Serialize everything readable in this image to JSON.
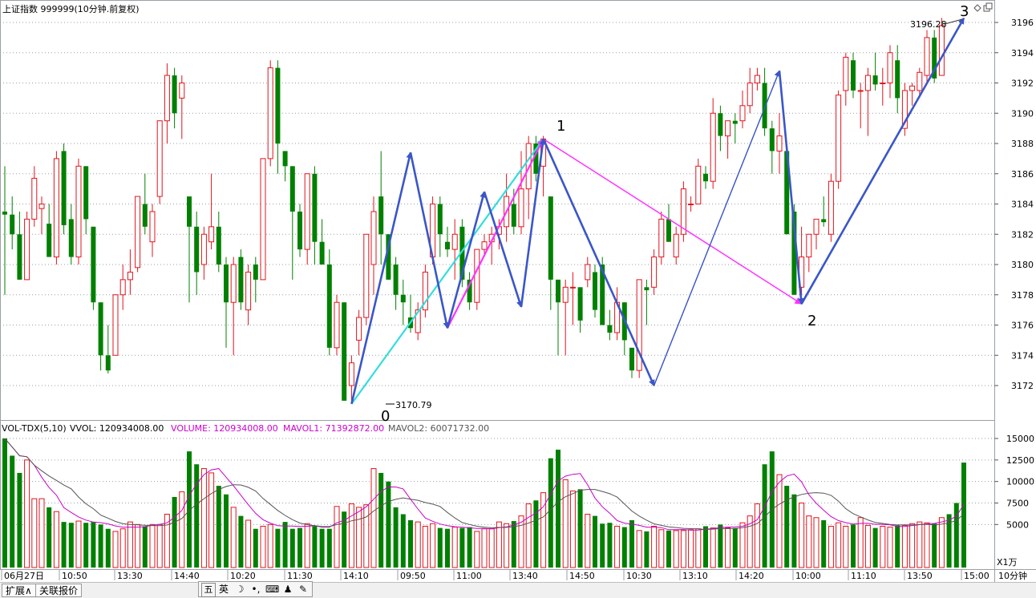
{
  "header": {
    "title": "上证指数 999999(10分钟.前复权)",
    "icons": [
      "diamond-icon",
      "restore-icon"
    ]
  },
  "volume_header": {
    "name": "VOL-TDX(5,10)",
    "vvol": "VVOL: 120934008.00",
    "volume": "VOLUME: 120934008.00",
    "mavol1": "MAVOL1: 71392872.00",
    "mavol2": "MAVOL2: 60071732.00"
  },
  "price_axis": [
    "3196",
    "3194",
    "3192",
    "3190",
    "3188",
    "3186",
    "3184",
    "3182",
    "3180",
    "3178",
    "3176",
    "3174",
    "3172"
  ],
  "volume_axis": [
    "15000",
    "12500",
    "10000",
    "7500",
    "5000"
  ],
  "volume_unit": "X1万",
  "time_axis": [
    "06月27日",
    "10:50",
    "13:30",
    "14:40",
    "10:20",
    "11:30",
    "14:10",
    "09:50",
    "11:00",
    "13:40",
    "14:50",
    "10:30",
    "13:10",
    "14:20",
    "10:00",
    "11:10",
    "13:50",
    "15:00"
  ],
  "period_label": "10分钟",
  "annotations": {
    "low_price": "3170.79",
    "high_price": "3196.28",
    "wave_labels": [
      "0",
      "1",
      "2",
      "3"
    ]
  },
  "status_bar": {
    "expand_button": "扩展∧",
    "quote_button": "关联报价",
    "ime_items": [
      "五",
      "英",
      "☽",
      "•,",
      "⌨",
      "♟",
      "✎"
    ]
  },
  "colors": {
    "up": "#e0141e",
    "down": "#008000",
    "ma1": "#cc00cc",
    "ma2": "#555555",
    "wave_blue": "#3a56c8",
    "magenta_line": "#ff33ff",
    "cyan_line": "#33dddd"
  },
  "chart_data": {
    "type": "candlestick",
    "ylim": [
      3170,
      3197
    ],
    "volume_ylim": [
      0,
      16000
    ],
    "candles": [
      {
        "o": 3183.5,
        "h": 3186.5,
        "l": 3178,
        "c": 3183.3
      },
      {
        "o": 3183.3,
        "h": 3184.5,
        "l": 3181,
        "c": 3182
      },
      {
        "o": 3182,
        "h": 3183.5,
        "l": 3179,
        "c": 3179
      },
      {
        "o": 3179,
        "h": 3183.5,
        "l": 3179,
        "c": 3183
      },
      {
        "o": 3183,
        "h": 3186.5,
        "l": 3182.5,
        "c": 3185.7
      },
      {
        "o": 3183.7,
        "h": 3184.5,
        "l": 3182,
        "c": 3184
      },
      {
        "o": 3182.7,
        "h": 3184,
        "l": 3180.5,
        "c": 3180.5
      },
      {
        "o": 3180.5,
        "h": 3187.5,
        "l": 3180,
        "c": 3187
      },
      {
        "o": 3187.5,
        "h": 3188,
        "l": 3182,
        "c": 3182.6
      },
      {
        "o": 3183,
        "h": 3184,
        "l": 3180,
        "c": 3180.5
      },
      {
        "o": 3180.5,
        "h": 3187,
        "l": 3180,
        "c": 3186.5
      },
      {
        "o": 3186.5,
        "h": 3186.5,
        "l": 3182,
        "c": 3183
      },
      {
        "o": 3182.5,
        "h": 3182.5,
        "l": 3177,
        "c": 3177.5
      },
      {
        "o": 3177.5,
        "h": 3177.5,
        "l": 3173,
        "c": 3174
      },
      {
        "o": 3174,
        "h": 3176,
        "l": 3172.8,
        "c": 3173
      },
      {
        "o": 3174,
        "h": 3178,
        "l": 3174,
        "c": 3178
      },
      {
        "o": 3178,
        "h": 3180,
        "l": 3177,
        "c": 3179
      },
      {
        "o": 3179,
        "h": 3181,
        "l": 3178,
        "c": 3179.5
      },
      {
        "o": 3179.8,
        "h": 3184.5,
        "l": 3179.5,
        "c": 3184.5
      },
      {
        "o": 3184,
        "h": 3186,
        "l": 3182,
        "c": 3182.5
      },
      {
        "o": 3181.5,
        "h": 3184,
        "l": 3180.5,
        "c": 3183.5
      },
      {
        "o": 3184.5,
        "h": 3189.5,
        "l": 3184,
        "c": 3189.5
      },
      {
        "o": 3189.5,
        "h": 3193.3,
        "l": 3188,
        "c": 3192.5
      },
      {
        "o": 3192.5,
        "h": 3193,
        "l": 3189,
        "c": 3190
      },
      {
        "o": 3191,
        "h": 3192.5,
        "l": 3188.3,
        "c": 3192
      },
      {
        "o": 3184.5,
        "h": 3184.5,
        "l": 3177.5,
        "c": 3182.5
      },
      {
        "o": 3182.5,
        "h": 3183.5,
        "l": 3178,
        "c": 3179.5
      },
      {
        "o": 3180,
        "h": 3182.5,
        "l": 3179,
        "c": 3182
      },
      {
        "o": 3181.5,
        "h": 3186,
        "l": 3181,
        "c": 3182.5
      },
      {
        "o": 3182.5,
        "h": 3183.5,
        "l": 3179.5,
        "c": 3180
      },
      {
        "o": 3180,
        "h": 3180.5,
        "l": 3174.5,
        "c": 3177.5
      },
      {
        "o": 3177.5,
        "h": 3180.5,
        "l": 3174,
        "c": 3180
      },
      {
        "o": 3180.5,
        "h": 3181,
        "l": 3177,
        "c": 3177.5
      },
      {
        "o": 3177,
        "h": 3180,
        "l": 3176,
        "c": 3179.5
      },
      {
        "o": 3180,
        "h": 3180.5,
        "l": 3177.5,
        "c": 3179
      },
      {
        "o": 3179,
        "h": 3187,
        "l": 3179,
        "c": 3187
      },
      {
        "o": 3187,
        "h": 3193.5,
        "l": 3186.5,
        "c": 3193
      },
      {
        "o": 3193,
        "h": 3193.5,
        "l": 3186,
        "c": 3188
      },
      {
        "o": 3187.5,
        "h": 3187.5,
        "l": 3185.5,
        "c": 3186.5
      },
      {
        "o": 3186.5,
        "h": 3186.5,
        "l": 3179,
        "c": 3183.5
      },
      {
        "o": 3183.5,
        "h": 3184,
        "l": 3180.5,
        "c": 3181
      },
      {
        "o": 3181,
        "h": 3186,
        "l": 3180,
        "c": 3186
      },
      {
        "o": 3186,
        "h": 3186.5,
        "l": 3180,
        "c": 3181.5
      },
      {
        "o": 3181.5,
        "h": 3183,
        "l": 3180,
        "c": 3180
      },
      {
        "o": 3180,
        "h": 3181,
        "l": 3174,
        "c": 3174.5
      },
      {
        "o": 3174.5,
        "h": 3178,
        "l": 3174,
        "c": 3177.5
      },
      {
        "o": 3177.5,
        "h": 3177.5,
        "l": 3171,
        "c": 3171
      },
      {
        "o": 3172,
        "h": 3174,
        "l": 3171,
        "c": 3173.5
      },
      {
        "o": 3175,
        "h": 3177,
        "l": 3174,
        "c": 3176.5
      },
      {
        "o": 3176.5,
        "h": 3182,
        "l": 3176,
        "c": 3182
      },
      {
        "o": 3180,
        "h": 3184.5,
        "l": 3178,
        "c": 3183.5
      },
      {
        "o": 3184.5,
        "h": 3187.5,
        "l": 3180,
        "c": 3182
      },
      {
        "o": 3182,
        "h": 3182,
        "l": 3179,
        "c": 3179
      },
      {
        "o": 3180,
        "h": 3180.5,
        "l": 3177,
        "c": 3178
      },
      {
        "o": 3178,
        "h": 3179,
        "l": 3176,
        "c": 3177.5
      },
      {
        "o": 3176.5,
        "h": 3178,
        "l": 3175.5,
        "c": 3175.8
      },
      {
        "o": 3175.5,
        "h": 3177.5,
        "l": 3175,
        "c": 3177
      },
      {
        "o": 3177,
        "h": 3180,
        "l": 3176.5,
        "c": 3179.5
      },
      {
        "o": 3180.5,
        "h": 3184.5,
        "l": 3180,
        "c": 3184
      },
      {
        "o": 3184,
        "h": 3184.5,
        "l": 3180.5,
        "c": 3182
      },
      {
        "o": 3181.5,
        "h": 3182.5,
        "l": 3180.5,
        "c": 3181
      },
      {
        "o": 3181,
        "h": 3183,
        "l": 3179,
        "c": 3182
      },
      {
        "o": 3182.5,
        "h": 3183,
        "l": 3178.5,
        "c": 3179
      },
      {
        "o": 3179,
        "h": 3179.5,
        "l": 3177,
        "c": 3177.5
      },
      {
        "o": 3177.5,
        "h": 3181,
        "l": 3177,
        "c": 3181
      },
      {
        "o": 3181,
        "h": 3182,
        "l": 3180.5,
        "c": 3181.5
      },
      {
        "o": 3181.5,
        "h": 3182.5,
        "l": 3180,
        "c": 3182
      },
      {
        "o": 3182,
        "h": 3183,
        "l": 3181,
        "c": 3182.5
      },
      {
        "o": 3182.5,
        "h": 3186,
        "l": 3181.5,
        "c": 3184.5
      },
      {
        "o": 3184,
        "h": 3185,
        "l": 3182,
        "c": 3182.5
      },
      {
        "o": 3182.5,
        "h": 3187.5,
        "l": 3182,
        "c": 3185
      },
      {
        "o": 3185,
        "h": 3188.5,
        "l": 3183,
        "c": 3188
      },
      {
        "o": 3188,
        "h": 3188.5,
        "l": 3185.5,
        "c": 3186
      },
      {
        "o": 3186.5,
        "h": 3188.5,
        "l": 3184.5,
        "c": 3188.3
      },
      {
        "o": 3184.5,
        "h": 3184.5,
        "l": 3177,
        "c": 3179
      },
      {
        "o": 3179,
        "h": 3179,
        "l": 3174,
        "c": 3177.5
      },
      {
        "o": 3177.5,
        "h": 3179,
        "l": 3174,
        "c": 3178.5
      },
      {
        "o": 3178.5,
        "h": 3179.5,
        "l": 3176,
        "c": 3178.5
      },
      {
        "o": 3178.5,
        "h": 3178.5,
        "l": 3175.5,
        "c": 3176.3
      },
      {
        "o": 3179,
        "h": 3180.5,
        "l": 3178.5,
        "c": 3180
      },
      {
        "o": 3179.5,
        "h": 3180,
        "l": 3176.5,
        "c": 3177
      },
      {
        "o": 3180,
        "h": 3180.5,
        "l": 3176,
        "c": 3176
      },
      {
        "o": 3176,
        "h": 3177,
        "l": 3175,
        "c": 3175.5
      },
      {
        "o": 3175.5,
        "h": 3178.5,
        "l": 3175,
        "c": 3177.5
      },
      {
        "o": 3177.5,
        "h": 3177.5,
        "l": 3174,
        "c": 3175
      },
      {
        "o": 3174.5,
        "h": 3174.5,
        "l": 3172.5,
        "c": 3173
      },
      {
        "o": 3173,
        "h": 3179,
        "l": 3172.5,
        "c": 3179
      },
      {
        "o": 3178.5,
        "h": 3179,
        "l": 3176,
        "c": 3178.3
      },
      {
        "o": 3178.5,
        "h": 3181,
        "l": 3178,
        "c": 3180.5
      },
      {
        "o": 3180.5,
        "h": 3183.5,
        "l": 3180,
        "c": 3183
      },
      {
        "o": 3183,
        "h": 3184,
        "l": 3181.5,
        "c": 3181.5
      },
      {
        "o": 3180.5,
        "h": 3182.5,
        "l": 3180,
        "c": 3182
      },
      {
        "o": 3182,
        "h": 3185.5,
        "l": 3181.5,
        "c": 3185
      },
      {
        "o": 3184,
        "h": 3184.5,
        "l": 3183.5,
        "c": 3184
      },
      {
        "o": 3184,
        "h": 3187,
        "l": 3184,
        "c": 3186.5
      },
      {
        "o": 3186,
        "h": 3186.5,
        "l": 3185,
        "c": 3185.5
      },
      {
        "o": 3185.5,
        "h": 3191,
        "l": 3185,
        "c": 3190
      },
      {
        "o": 3190,
        "h": 3190.5,
        "l": 3187.5,
        "c": 3188.5
      },
      {
        "o": 3188.5,
        "h": 3189.5,
        "l": 3187,
        "c": 3189.5
      },
      {
        "o": 3189.5,
        "h": 3190,
        "l": 3188,
        "c": 3189.3
      },
      {
        "o": 3189.5,
        "h": 3191.5,
        "l": 3189,
        "c": 3190.5
      },
      {
        "o": 3190.5,
        "h": 3193,
        "l": 3190,
        "c": 3192
      },
      {
        "o": 3192,
        "h": 3193,
        "l": 3191.5,
        "c": 3192.5
      },
      {
        "o": 3192,
        "h": 3193,
        "l": 3188.5,
        "c": 3189
      },
      {
        "o": 3189,
        "h": 3189.5,
        "l": 3186,
        "c": 3187.5
      },
      {
        "o": 3187.5,
        "h": 3190,
        "l": 3186,
        "c": 3188.5
      },
      {
        "o": 3187.5,
        "h": 3188,
        "l": 3182,
        "c": 3182
      },
      {
        "o": 3183.5,
        "h": 3184,
        "l": 3178,
        "c": 3178
      },
      {
        "o": 3178.5,
        "h": 3182.5,
        "l": 3178,
        "c": 3180.5
      },
      {
        "o": 3180.5,
        "h": 3181.5,
        "l": 3179.5,
        "c": 3182
      },
      {
        "o": 3182,
        "h": 3183,
        "l": 3181,
        "c": 3183
      },
      {
        "o": 3183,
        "h": 3184.5,
        "l": 3182.5,
        "c": 3182.8
      },
      {
        "o": 3182,
        "h": 3186,
        "l": 3181.5,
        "c": 3185.5
      },
      {
        "o": 3185.5,
        "h": 3191.5,
        "l": 3185,
        "c": 3191.2
      },
      {
        "o": 3191.5,
        "h": 3194,
        "l": 3190.5,
        "c": 3193.7
      },
      {
        "o": 3193.5,
        "h": 3194,
        "l": 3191,
        "c": 3191.5
      },
      {
        "o": 3191.5,
        "h": 3192,
        "l": 3189,
        "c": 3191.5
      },
      {
        "o": 3191.5,
        "h": 3193,
        "l": 3188.5,
        "c": 3192.5
      },
      {
        "o": 3192.5,
        "h": 3194,
        "l": 3191.5,
        "c": 3191.9
      },
      {
        "o": 3192,
        "h": 3193,
        "l": 3190.5,
        "c": 3192
      },
      {
        "o": 3192,
        "h": 3194.5,
        "l": 3191,
        "c": 3194
      },
      {
        "o": 3193.5,
        "h": 3194.5,
        "l": 3190,
        "c": 3191
      },
      {
        "o": 3189,
        "h": 3192,
        "l": 3188.5,
        "c": 3191.5
      },
      {
        "o": 3191.5,
        "h": 3192,
        "l": 3190.5,
        "c": 3191.8
      },
      {
        "o": 3191.5,
        "h": 3193,
        "l": 3191,
        "c": 3192.7
      },
      {
        "o": 3192.5,
        "h": 3195.5,
        "l": 3192,
        "c": 3195
      },
      {
        "o": 3195,
        "h": 3195.5,
        "l": 3192,
        "c": 3192.3
      },
      {
        "o": 3192.5,
        "h": 3196.3,
        "l": 3192.5,
        "c": 3195.8
      }
    ],
    "volumes": [
      15000,
      13000,
      11000,
      12500,
      8000,
      8000,
      7000,
      6500,
      5300,
      5200,
      5400,
      5200,
      5300,
      5000,
      4500,
      4200,
      4500,
      5300,
      5000,
      4800,
      5000,
      5000,
      6200,
      8200,
      8800,
      13500,
      12000,
      11500,
      11000,
      9500,
      8500,
      7000,
      6000,
      5500,
      4500,
      4800,
      5000,
      4500,
      5300,
      4500,
      4600,
      5100,
      4800,
      4500,
      4500,
      7100,
      6500,
      7400,
      7000,
      7300,
      11500,
      11000,
      10000,
      7000,
      6200,
      5500,
      5300,
      4800,
      5100,
      4600,
      4500,
      4700,
      4600,
      4700,
      4200,
      4500,
      4500,
      5300,
      5100,
      5400,
      6000,
      7400,
      7800,
      8700,
      12700,
      13700,
      10200,
      8900,
      9100,
      6200,
      6000,
      5100,
      5200,
      4800,
      4700,
      5500,
      4300,
      4200,
      4800,
      4400,
      4300,
      4300,
      4300,
      4400,
      4500,
      4800,
      4600,
      5000,
      4600,
      4600,
      5200,
      6000,
      7400,
      12000,
      13500,
      10800,
      9500,
      8500,
      7500,
      6000,
      5800,
      5500,
      4800,
      5200,
      4800,
      5000,
      5800,
      4900,
      4600,
      4800,
      4700,
      4900,
      4900,
      5100,
      5300,
      5200,
      5100,
      5800,
      6200,
      7500,
      12200
    ],
    "wave_points": [
      {
        "label": "0",
        "candle": 47,
        "price": 3170.79
      },
      {
        "label": "1",
        "candle": 73,
        "price": 3188.3
      },
      {
        "label": "2",
        "candle": 108,
        "price": 3177.4
      },
      {
        "label": "3",
        "candle": 130,
        "price": 3196.28
      }
    ]
  }
}
